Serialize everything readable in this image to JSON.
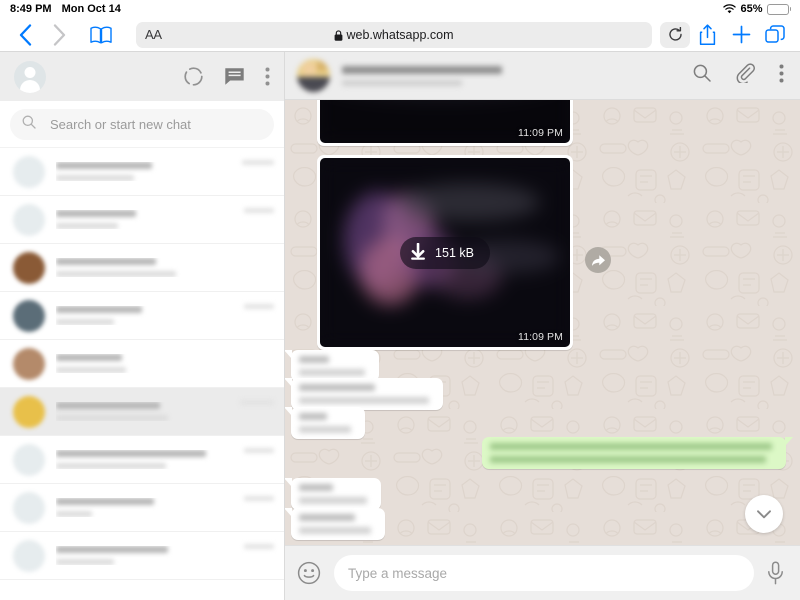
{
  "statusbar": {
    "time": "8:49 PM",
    "date": "Mon Oct 14",
    "wifi_icon": "wifi-icon",
    "battery_percent": "65%",
    "battery_level": 65
  },
  "browser": {
    "back_icon": "chevron-left-icon",
    "forward_icon": "chevron-right-icon",
    "bookmarks_icon": "book-icon",
    "text_size_label": "AA",
    "lock_icon": "lock-icon",
    "url": "web.whatsapp.com",
    "reload_icon": "reload-icon",
    "share_icon": "share-icon",
    "new_tab_icon": "plus-icon",
    "tabs_icon": "tabs-icon"
  },
  "sidebar": {
    "profile_avatar": "default-avatar",
    "status_icon": "status-circle-icon",
    "new_chat_icon": "new-chat-icon",
    "menu_icon": "overflow-menu-icon",
    "search": {
      "icon": "search-icon",
      "placeholder": "Search or start new chat",
      "value": ""
    },
    "chats": [
      {
        "name_redacted": true,
        "name_w": 96,
        "msg_w": 78,
        "time_w": 32,
        "avatar": "#e6ecee",
        "selected": false
      },
      {
        "name_redacted": true,
        "name_w": 80,
        "msg_w": 62,
        "time_w": 30,
        "avatar": "#e6ecee",
        "selected": false
      },
      {
        "name_redacted": true,
        "name_w": 100,
        "msg_w": 120,
        "time_w": 0,
        "avatar": "#8a5a36",
        "selected": false
      },
      {
        "name_redacted": true,
        "name_w": 86,
        "msg_w": 58,
        "time_w": 30,
        "avatar": "#5b6d78",
        "selected": false
      },
      {
        "name_redacted": true,
        "name_w": 66,
        "msg_w": 70,
        "time_w": 0,
        "avatar": "#b48a6a",
        "selected": false
      },
      {
        "name_redacted": true,
        "name_w": 104,
        "msg_w": 112,
        "time_w": 34,
        "avatar": "#e8c04a",
        "selected": true
      },
      {
        "name_redacted": true,
        "name_w": 150,
        "msg_w": 110,
        "time_w": 30,
        "avatar": "#e6ecee",
        "selected": false
      },
      {
        "name_redacted": true,
        "name_w": 98,
        "msg_w": 36,
        "time_w": 30,
        "avatar": "#e6ecee",
        "selected": false
      },
      {
        "name_redacted": true,
        "name_w": 112,
        "msg_w": 58,
        "time_w": 30,
        "avatar": "#e6ecee",
        "selected": false
      }
    ]
  },
  "chat": {
    "header": {
      "avatar": "contact-avatar-redacted",
      "name_redacted": true,
      "status_redacted": true,
      "search_icon": "search-icon",
      "attach_icon": "paperclip-icon",
      "menu_icon": "overflow-menu-icon"
    },
    "messages": [
      {
        "type": "media",
        "direction": "in",
        "timestamp": "11:09 PM",
        "partial": true
      },
      {
        "type": "media",
        "direction": "in",
        "timestamp": "11:09 PM",
        "download_icon": "download-arrow-icon",
        "download_size": "151 kB",
        "forward_icon": "forward-arrow-icon"
      },
      {
        "type": "text",
        "direction": "in",
        "redacted": true,
        "lines": [
          30,
          66
        ]
      },
      {
        "type": "text",
        "direction": "in",
        "redacted": true,
        "lines": [
          76,
          130
        ]
      },
      {
        "type": "text",
        "direction": "in",
        "redacted": true,
        "lines": [
          28,
          52
        ]
      },
      {
        "type": "text",
        "direction": "out",
        "redacted": true,
        "lines": [
          282,
          276
        ]
      },
      {
        "type": "text",
        "direction": "in",
        "redacted": true,
        "lines": [
          34,
          68
        ]
      },
      {
        "type": "text",
        "direction": "in",
        "redacted": true,
        "lines": [
          56,
          72
        ]
      }
    ],
    "scroll_down_icon": "chevron-down-icon",
    "composer": {
      "emoji_icon": "emoji-icon",
      "placeholder": "Type a message",
      "value": "",
      "mic_icon": "microphone-icon"
    }
  },
  "colors": {
    "accent_blue": "#007aff",
    "wa_header": "#ededed",
    "wa_chat_bg": "#e6ded8",
    "bubble_out": "#dcf8c6",
    "bubble_in": "#ffffff"
  }
}
